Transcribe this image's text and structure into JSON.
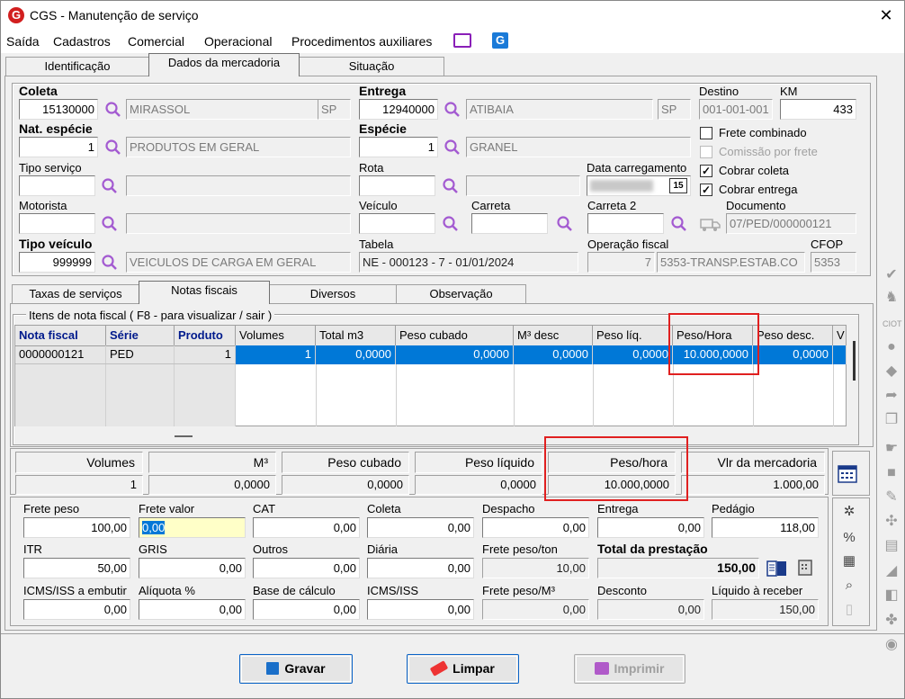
{
  "window": {
    "title": "CGS - Manutenção de serviço",
    "close": "✕",
    "logo": "G"
  },
  "menu": [
    "Saída",
    "Cadastros",
    "Comercial",
    "Operacional",
    "Procedimentos auxiliares"
  ],
  "tabs": [
    "Identificação",
    "Dados da mercadoria",
    "Situação"
  ],
  "form": {
    "coleta": {
      "label": "Coleta",
      "code": "15130000",
      "city": "MIRASSOL",
      "uf": "SP"
    },
    "entrega": {
      "label": "Entrega",
      "code": "12940000",
      "city": "ATIBAIA",
      "uf": "SP"
    },
    "destino": {
      "label": "Destino",
      "value": "001-001-001"
    },
    "km": {
      "label": "KM",
      "value": "433"
    },
    "nat_especie": {
      "label": "Nat. espécie",
      "code": "1",
      "desc": "PRODUTOS EM GERAL"
    },
    "especie": {
      "label": "Espécie",
      "code": "1",
      "desc": "GRANEL"
    },
    "tipo_servico": {
      "label": "Tipo serviço",
      "code": "",
      "desc": ""
    },
    "rota": {
      "label": "Rota",
      "code": "",
      "desc": ""
    },
    "data_carregamento": {
      "label": "Data carregamento",
      "value": "",
      "cal": "15"
    },
    "motorista": {
      "label": "Motorista",
      "code": "",
      "desc": ""
    },
    "veiculo": {
      "label": "Veículo",
      "value": ""
    },
    "carreta": {
      "label": "Carreta",
      "value": ""
    },
    "carreta2": {
      "label": "Carreta 2",
      "value": ""
    },
    "documento": {
      "label": "Documento",
      "value": "07/PED/000000121"
    },
    "tipo_veiculo": {
      "label": "Tipo veículo",
      "code": "999999",
      "desc": "VEICULOS DE CARGA EM GERAL"
    },
    "tabela": {
      "label": "Tabela",
      "value": "NE - 000123 - 7 - 01/01/2024"
    },
    "operacao_fiscal": {
      "label": "Operação fiscal",
      "code": "7",
      "desc": "5353-TRANSP.ESTAB.CO"
    },
    "cfop": {
      "label": "CFOP",
      "value": "5353"
    },
    "checks": [
      {
        "label": "Frete combinado",
        "checked": false,
        "enabled": true
      },
      {
        "label": "Comissão por frete",
        "checked": false,
        "enabled": false
      },
      {
        "label": "Cobrar coleta",
        "checked": true,
        "enabled": true
      },
      {
        "label": "Cobrar entrega",
        "checked": true,
        "enabled": true
      }
    ]
  },
  "subtabs": [
    "Taxas de serviços",
    "Notas fiscais",
    "Diversos",
    "Observação"
  ],
  "grid": {
    "group_title": "Itens de nota fiscal ( F8 - para visualizar / sair )",
    "headers": [
      "Nota fiscal",
      "Série",
      "Produto",
      "Volumes",
      "Total m3",
      "Peso cubado",
      "M³ desc",
      "Peso líq.",
      "Peso/Hora",
      "Peso desc.",
      "V"
    ],
    "row": [
      "0000000121",
      "PED",
      "1",
      "1",
      "0,0000",
      "0,0000",
      "0,0000",
      "0,0000",
      "10.000,0000",
      "0,0000",
      ""
    ]
  },
  "summary": {
    "headers": [
      "Volumes",
      "M³",
      "Peso cubado",
      "Peso líquido",
      "Peso/hora",
      "Vlr da mercadoria"
    ],
    "values": [
      "1",
      "0,0000",
      "0,0000",
      "0,0000",
      "10.000,0000",
      "1.000,00"
    ]
  },
  "fees": {
    "row1": [
      {
        "label": "Frete peso",
        "value": "100,00"
      },
      {
        "label": "Frete valor",
        "value": "0,00"
      },
      {
        "label": "CAT",
        "value": "0,00"
      },
      {
        "label": "Coleta",
        "value": "0,00"
      },
      {
        "label": "Despacho",
        "value": "0,00"
      },
      {
        "label": "Entrega",
        "value": "0,00"
      },
      {
        "label": "Pedágio",
        "value": "118,00"
      }
    ],
    "row2": [
      {
        "label": "ITR",
        "value": "50,00"
      },
      {
        "label": "GRIS",
        "value": "0,00"
      },
      {
        "label": "Outros",
        "value": "0,00"
      },
      {
        "label": "Diária",
        "value": "0,00"
      },
      {
        "label": "Frete peso/ton",
        "value": "10,00"
      },
      {
        "label": "Total da prestação",
        "value": "150,00"
      }
    ],
    "row3": [
      {
        "label": "ICMS/ISS a embutir",
        "value": "0,00"
      },
      {
        "label": "Alíquota %",
        "value": "0,00"
      },
      {
        "label": "Base de cálculo",
        "value": "0,00"
      },
      {
        "label": "ICMS/ISS",
        "value": "0,00"
      },
      {
        "label": "Frete peso/M³",
        "value": "0,00"
      },
      {
        "label": "Desconto",
        "value": "0,00"
      },
      {
        "label": "Líquido à receber",
        "value": "150,00"
      }
    ]
  },
  "buttons": {
    "save": "Gravar",
    "clear": "Limpar",
    "print": "Imprimir"
  },
  "colors": {
    "accent": "#0078d7",
    "highlight": "#e02020",
    "header_blue": "#001a8c"
  }
}
